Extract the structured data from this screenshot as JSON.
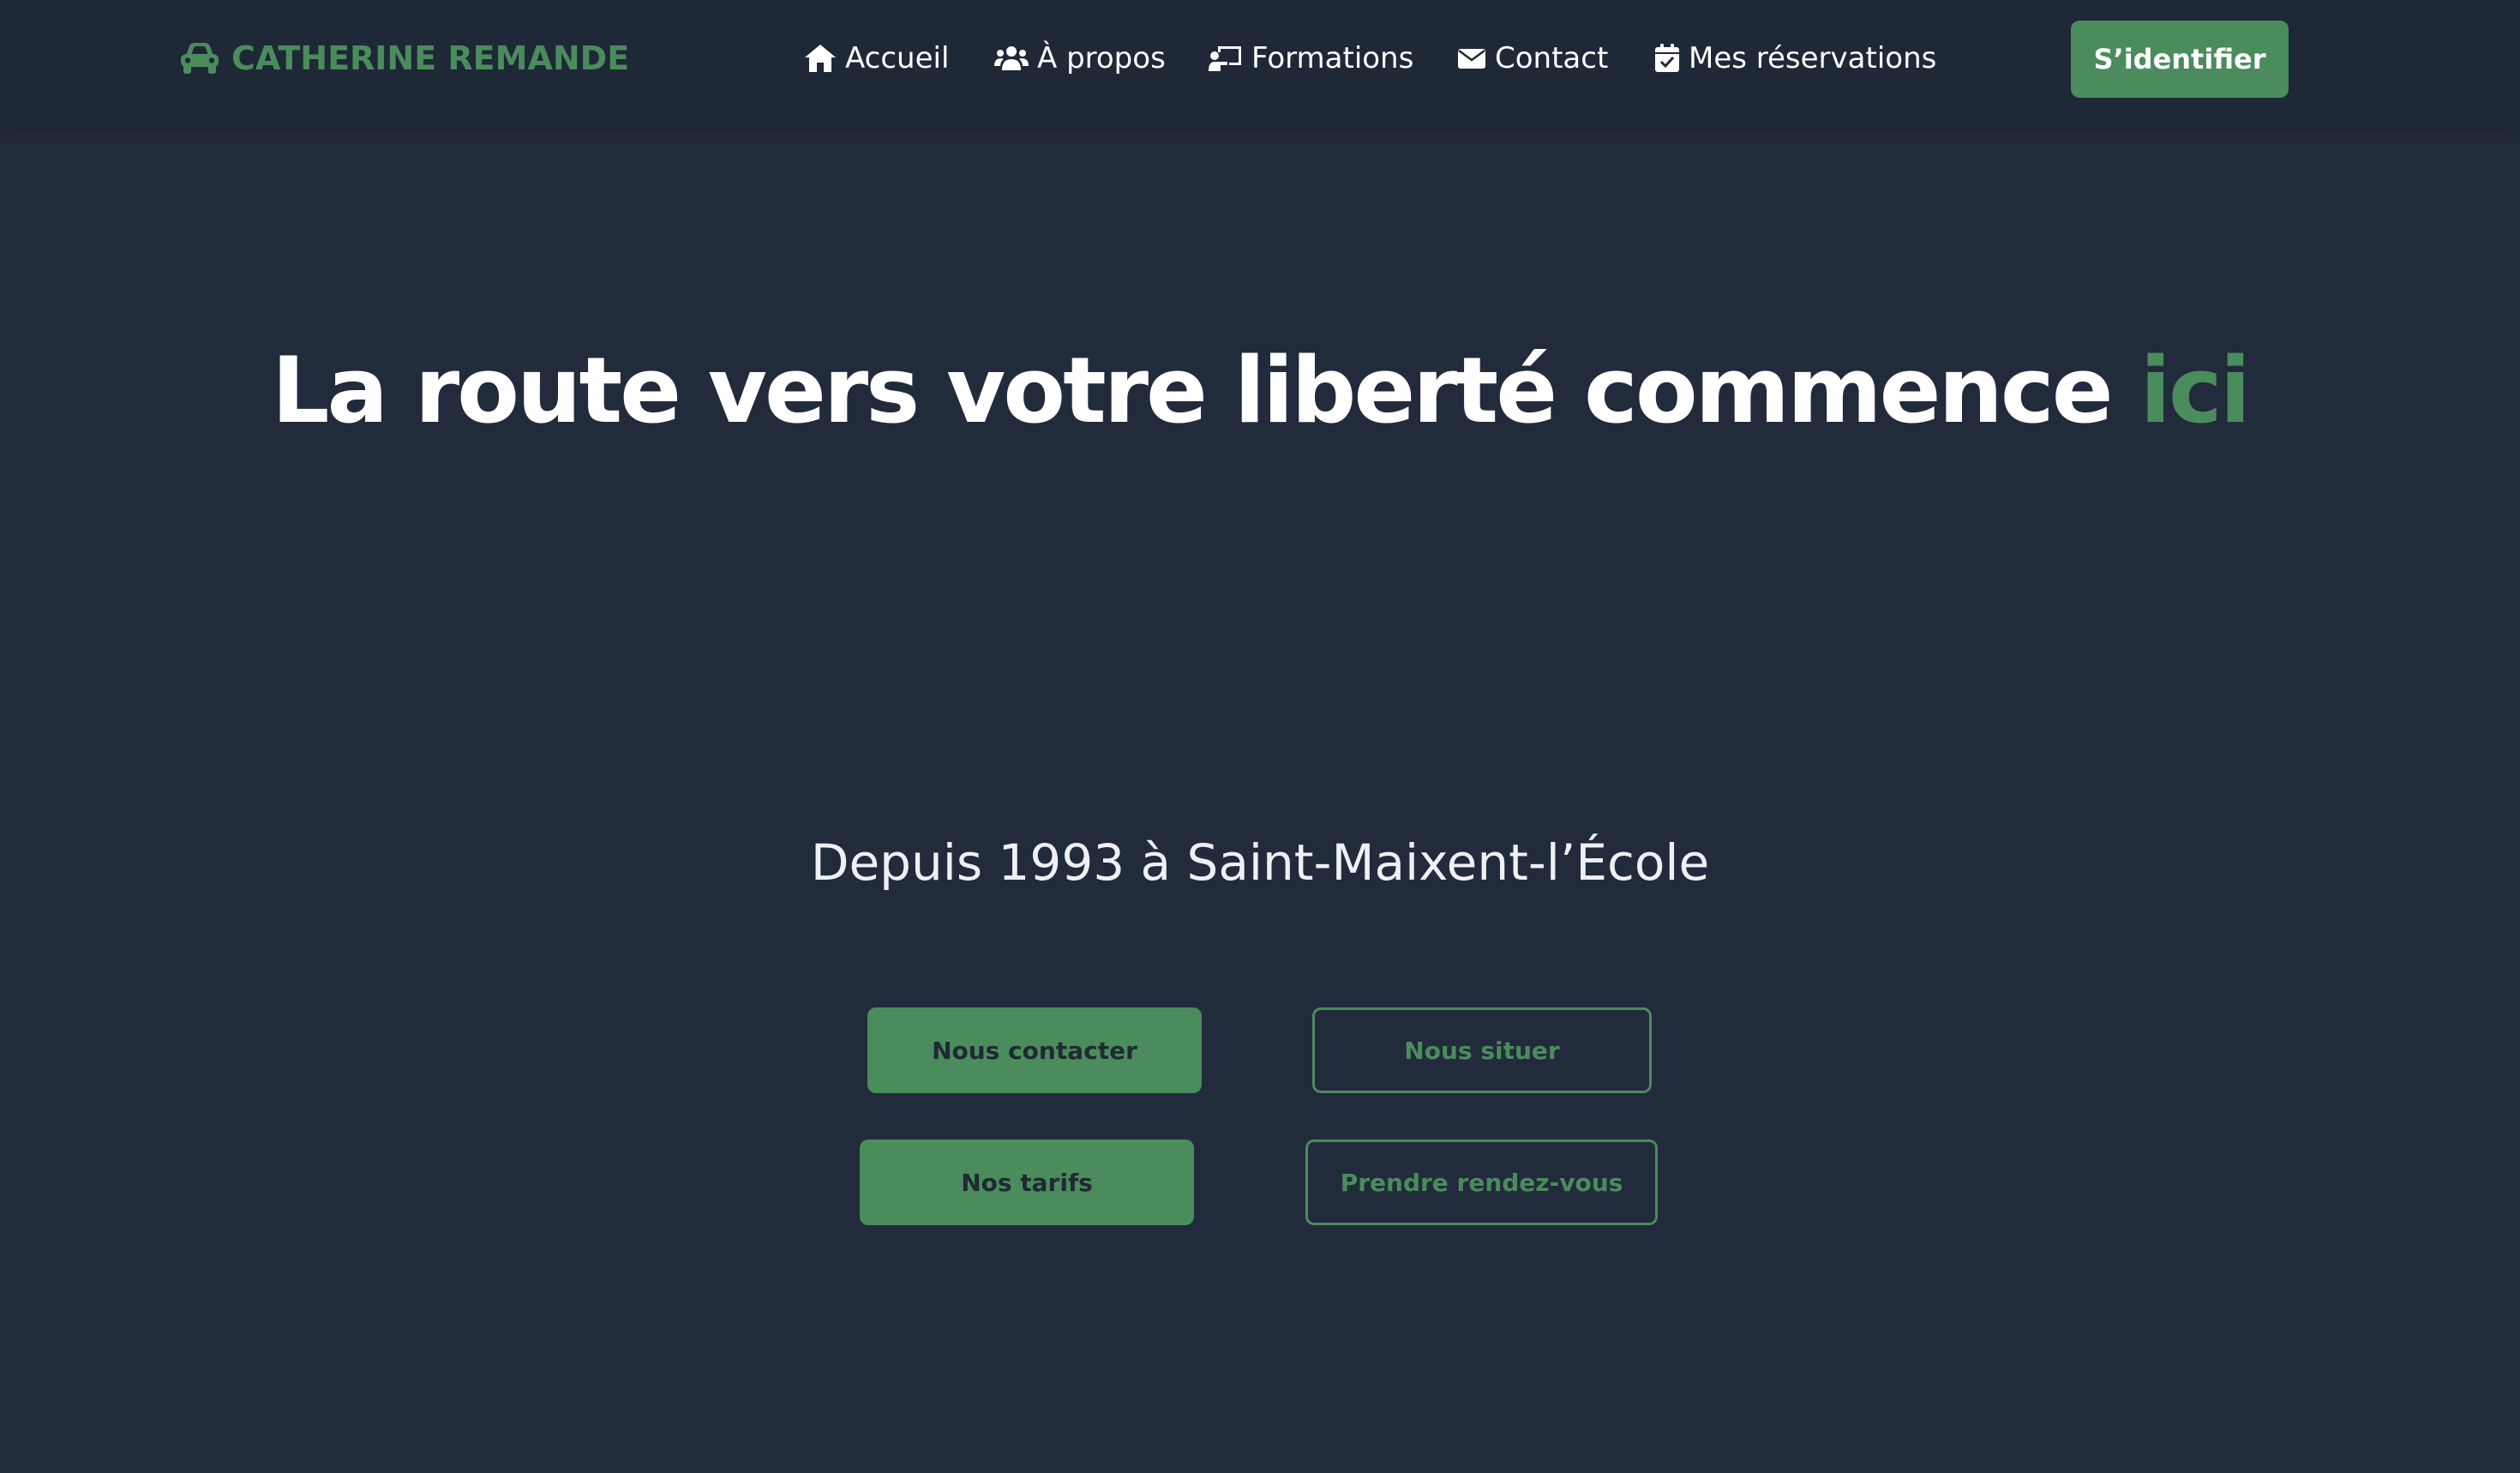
{
  "brand": {
    "name": "CATHERINE REMANDE",
    "icon": "car-icon",
    "color": "#4a8c5c"
  },
  "nav": {
    "items": [
      {
        "label": "Accueil",
        "icon": "home-icon"
      },
      {
        "label": "À propos",
        "icon": "users-icon"
      },
      {
        "label": "Formations",
        "icon": "chalkboard-teacher-icon"
      },
      {
        "label": "Contact",
        "icon": "envelope-icon"
      },
      {
        "label": "Mes réservations",
        "icon": "calendar-check-icon"
      }
    ],
    "login_label": "S’identifier"
  },
  "hero": {
    "title_main": "La route vers votre liberté commence",
    "title_accent": "ici",
    "subtitle": "Depuis 1993 à Saint-Maixent-l’École"
  },
  "actions": {
    "contact_label": "Nous contacter",
    "locate_label": "Nous situer",
    "prices_label": "Nos tarifs",
    "appointment_label": "Prendre rendez-vous"
  },
  "colors": {
    "background": "#222b3b",
    "navbar": "#1f2837",
    "accent": "#4a8c5c",
    "text": "#ffffff"
  }
}
